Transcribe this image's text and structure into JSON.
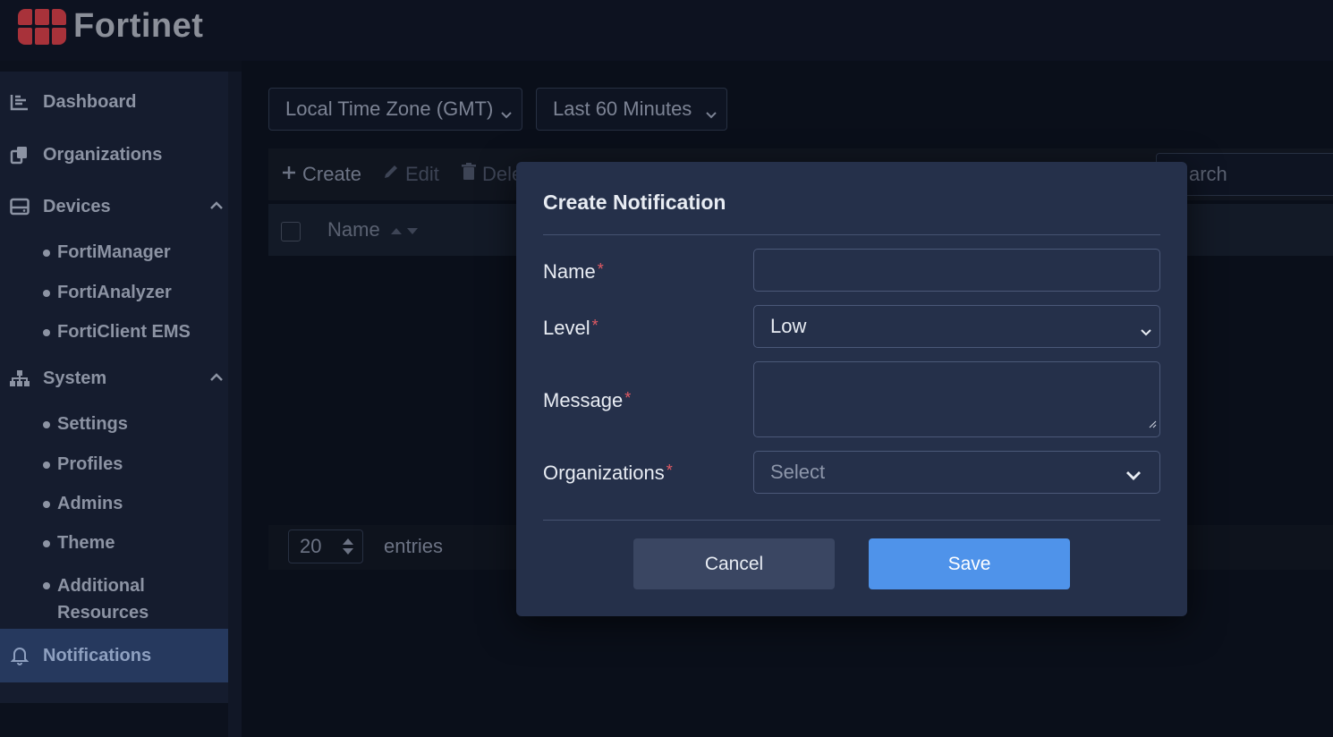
{
  "brand": {
    "name": "Fortinet",
    "color": "#a8323a"
  },
  "sidebar": {
    "items": [
      {
        "label": "Dashboard",
        "icon": "chart-line-icon"
      },
      {
        "label": "Organizations",
        "icon": "copy-icon"
      },
      {
        "label": "Devices",
        "icon": "hdd-icon",
        "expanded": true,
        "children": [
          "FortiManager",
          "FortiAnalyzer",
          "FortiClient EMS"
        ]
      },
      {
        "label": "System",
        "icon": "sitemap-icon",
        "expanded": true,
        "children": [
          "Settings",
          "Profiles",
          "Admins",
          "Theme",
          "Additional Resources"
        ]
      },
      {
        "label": "Notifications",
        "icon": "bell-icon",
        "active": true
      }
    ]
  },
  "filters": {
    "timezone": "Local Time Zone (GMT)",
    "range": "Last 60 Minutes"
  },
  "toolbar": {
    "create": "Create",
    "edit": "Edit",
    "delete": "Dele"
  },
  "search": {
    "placeholder": "arch"
  },
  "table": {
    "columns": [
      "Name"
    ]
  },
  "pagination": {
    "page_size": "20",
    "label": "entries"
  },
  "modal": {
    "title": "Create Notification",
    "fields": {
      "name": {
        "label": "Name",
        "value": ""
      },
      "level": {
        "label": "Level",
        "value": "Low"
      },
      "message": {
        "label": "Message",
        "value": ""
      },
      "organizations": {
        "label": "Organizations",
        "placeholder": "Select"
      }
    },
    "required_mark": "*",
    "cancel": "Cancel",
    "save": "Save"
  },
  "colors": {
    "accent": "#4f93ea",
    "required": "#e35a63",
    "active_nav": "#26395e"
  }
}
